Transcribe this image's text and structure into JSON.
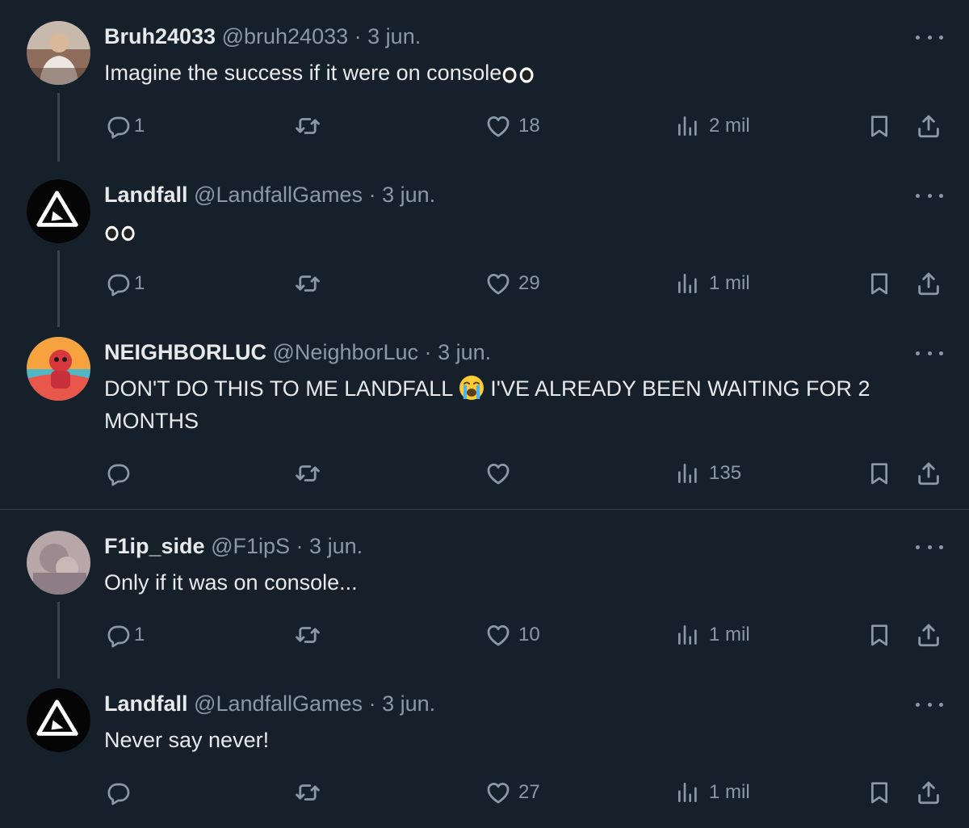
{
  "tweets": [
    {
      "name": "Bruh24033",
      "handle": "@bruh24033",
      "separator": "·",
      "date": "3 jun.",
      "text": "Imagine the success if it were on console",
      "emoji": "eyes",
      "replies": "1",
      "retweets": "",
      "likes": "18",
      "views": "2 mil"
    },
    {
      "name": "Landfall",
      "handle": "@LandfallGames",
      "separator": "·",
      "date": "3 jun.",
      "text": "",
      "emoji": "eyes",
      "replies": "1",
      "retweets": "",
      "likes": "29",
      "views": "1 mil"
    },
    {
      "name": "NEIGHBORLUC",
      "handle": "@NeighborLuc",
      "separator": "·",
      "date": "3 jun.",
      "text_part1": "DON'T DO THIS TO ME LANDFALL",
      "emoji": "loudly-crying-face",
      "text_part2": "I'VE ALREADY BEEN WAITING FOR 2 MONTHS",
      "replies": "",
      "retweets": "",
      "likes": "",
      "views": "135"
    },
    {
      "name": "F1ip_side",
      "handle": "@F1ipS",
      "separator": "·",
      "date": "3 jun.",
      "text": "Only if it was on console...",
      "replies": "1",
      "retweets": "",
      "likes": "10",
      "views": "1 mil"
    },
    {
      "name": "Landfall",
      "handle": "@LandfallGames",
      "separator": "·",
      "date": "3 jun.",
      "text": "Never say never!",
      "replies": "",
      "retweets": "",
      "likes": "27",
      "views": "1 mil"
    }
  ],
  "colors": {
    "background": "#15202b",
    "text_primary": "#e7e9ea",
    "text_secondary": "#8b98a5",
    "line": "#38444d"
  },
  "icons": [
    "reply-icon",
    "retweet-icon",
    "like-icon",
    "views-icon",
    "bookmark-icon",
    "share-icon",
    "more-icon",
    "eyes-emoji",
    "loudly-crying-face-emoji",
    "landfall-logo"
  ]
}
